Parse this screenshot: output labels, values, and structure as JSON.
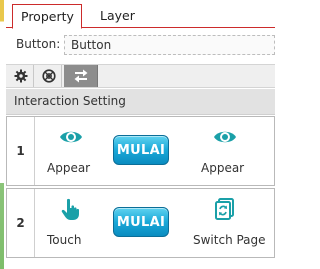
{
  "tabs": [
    {
      "label": "Property",
      "active": true
    },
    {
      "label": "Layer",
      "active": false
    }
  ],
  "button_field": {
    "label": "Button:",
    "value": "Button"
  },
  "toolbar": {
    "icons": [
      "gear-icon",
      "target-icon",
      "swap-arrows-icon"
    ],
    "active_index": 2
  },
  "section_title": "Interaction Setting",
  "interactions": [
    {
      "index": "1",
      "trigger_icon": "eye-icon",
      "trigger_label": "Appear",
      "button_label": "MULAI",
      "action_icon": "eye-icon",
      "action_label": "Appear"
    },
    {
      "index": "2",
      "trigger_icon": "touch-hand-icon",
      "trigger_label": "Touch",
      "button_label": "MULAI",
      "action_icon": "switch-page-icon",
      "action_label": "Switch Page"
    }
  ],
  "colors": {
    "accent_teal": "#1aa0a8",
    "tab_border_red": "#cc2b2b",
    "mulai_blue": "#1aa8d8"
  }
}
